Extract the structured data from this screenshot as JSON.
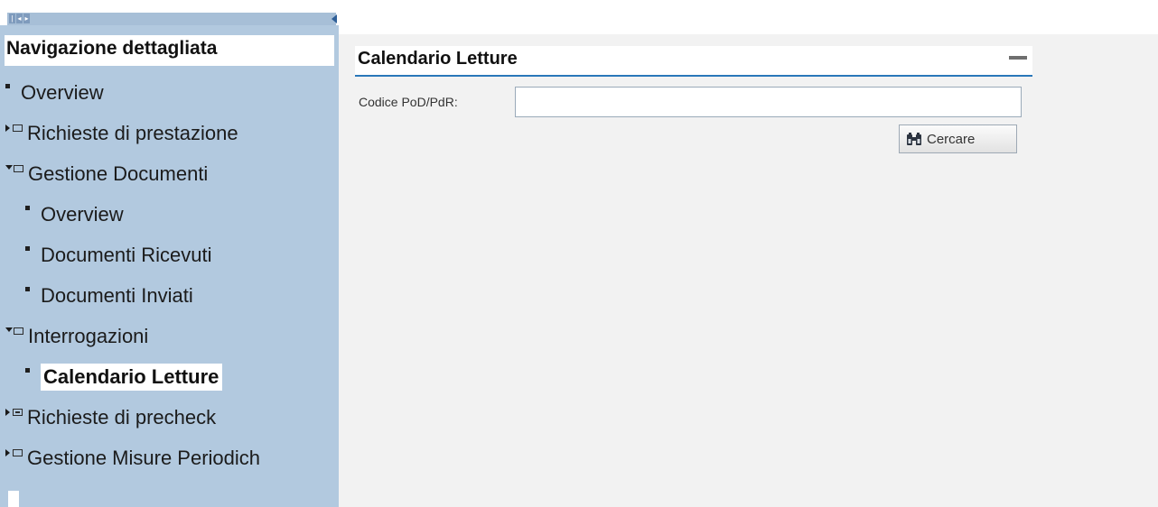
{
  "sidebar": {
    "title": "Navigazione dettagliata",
    "pager": {
      "first": "|",
      "prev": "◂",
      "next": "▸"
    },
    "items": [
      {
        "label": "Overview",
        "level": 0,
        "type": "leaf",
        "selected": false
      },
      {
        "label": "Richieste di prestazione",
        "level": 0,
        "type": "folder-collapsed",
        "selected": false
      },
      {
        "label": "Gestione Documenti",
        "level": 0,
        "type": "folder-expanded",
        "selected": false
      },
      {
        "label": "Overview",
        "level": 1,
        "type": "leaf",
        "selected": false
      },
      {
        "label": "Documenti Ricevuti",
        "level": 1,
        "type": "leaf",
        "selected": false
      },
      {
        "label": "Documenti Inviati",
        "level": 1,
        "type": "leaf",
        "selected": false
      },
      {
        "label": "Interrogazioni",
        "level": 0,
        "type": "folder-expanded",
        "selected": false
      },
      {
        "label": "Calendario Letture",
        "level": 1,
        "type": "leaf",
        "selected": true
      },
      {
        "label": "Richieste di precheck",
        "level": 0,
        "type": "folder-collapsed-special",
        "selected": false
      },
      {
        "label": "Gestione Misure Periodich",
        "level": 0,
        "type": "folder-collapsed",
        "selected": false
      }
    ]
  },
  "main": {
    "panel_title": "Calendario Letture",
    "field_label": "Codice PoD/PdR:",
    "field_value": "",
    "search_label": "Cercare"
  },
  "colors": {
    "sidebar_bg": "#b2c9df",
    "accent": "#2a78b9",
    "main_bg": "#f2f2f2"
  }
}
